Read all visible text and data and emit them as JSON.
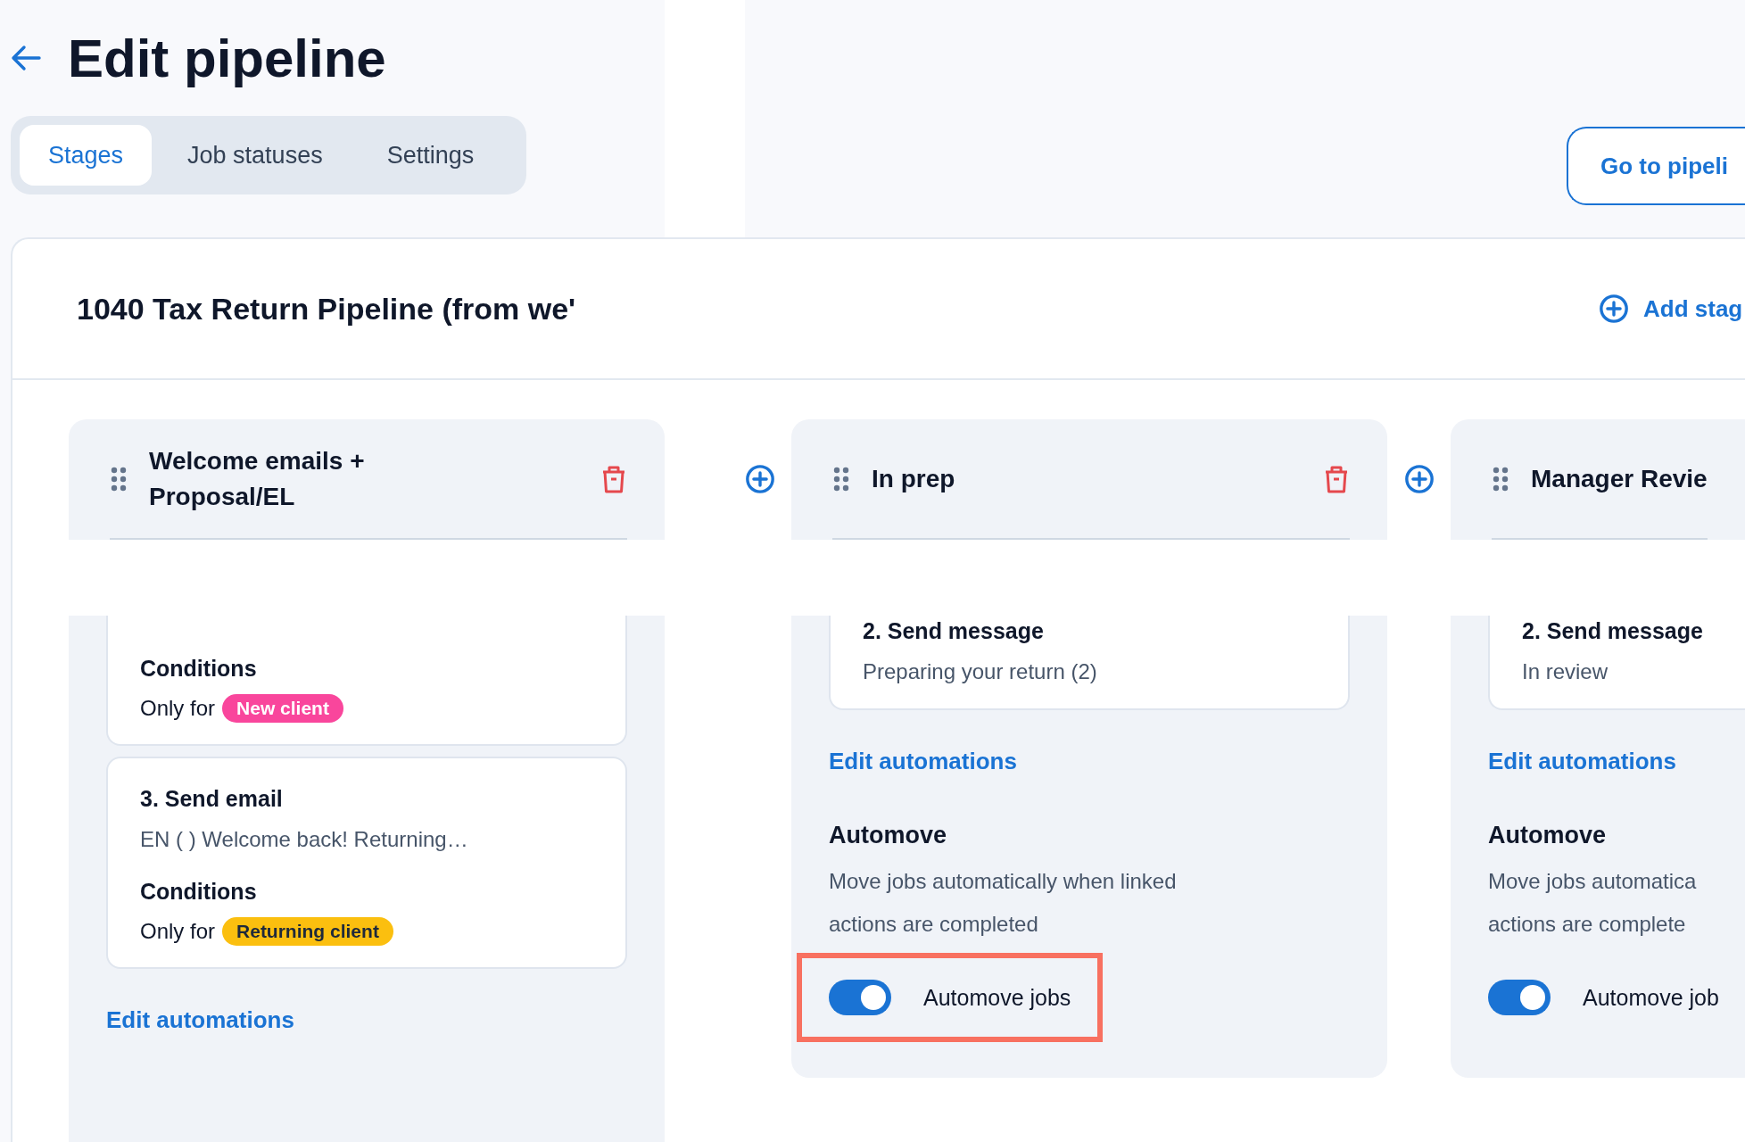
{
  "header": {
    "title": "Edit pipeline"
  },
  "tabs": [
    {
      "label": "Stages",
      "selected": true
    },
    {
      "label": "Job statuses",
      "selected": false
    },
    {
      "label": "Settings",
      "selected": false
    }
  ],
  "go_to_pipeline_button": "Go to pipeli",
  "pipeline": {
    "name": "1040 Tax Return Pipeline (from we'",
    "add_stage": "Add stag"
  },
  "stages": [
    {
      "name": "Welcome emails + Proposal/EL",
      "show_delete": true,
      "actions": [
        {
          "conditions_label": "Conditions",
          "condition_prefix": "Only for",
          "condition_tag": {
            "label": "New client",
            "color": "#f9469c"
          }
        },
        {
          "title": "3. Send email",
          "subtitle": "EN ( ) Welcome back! Returning…",
          "conditions_label": "Conditions",
          "condition_prefix": "Only for",
          "condition_tag": {
            "label": "Returning client",
            "color": "#fbbf0f"
          }
        }
      ],
      "edit_link": "Edit automations"
    },
    {
      "name": "In prep",
      "show_delete": true,
      "actions": [
        {
          "title": "2. Send message",
          "subtitle": "Preparing your return (2)"
        }
      ],
      "edit_link": "Edit automations",
      "automove": {
        "title": "Automove",
        "description_lines": [
          "Move jobs automatically when linked",
          "actions are completed"
        ],
        "toggle": {
          "label": "Automove jobs",
          "on": true,
          "highlighted": true
        }
      }
    },
    {
      "name": "Manager Revie",
      "show_delete": false,
      "actions": [
        {
          "title": "2. Send message",
          "subtitle": "In review"
        }
      ],
      "edit_link": "Edit automations",
      "automove": {
        "title": "Automove",
        "description_lines": [
          "Move jobs automatica",
          "actions are complete"
        ],
        "toggle": {
          "label": "Automove job",
          "on": true,
          "highlighted": false
        }
      }
    }
  ]
}
